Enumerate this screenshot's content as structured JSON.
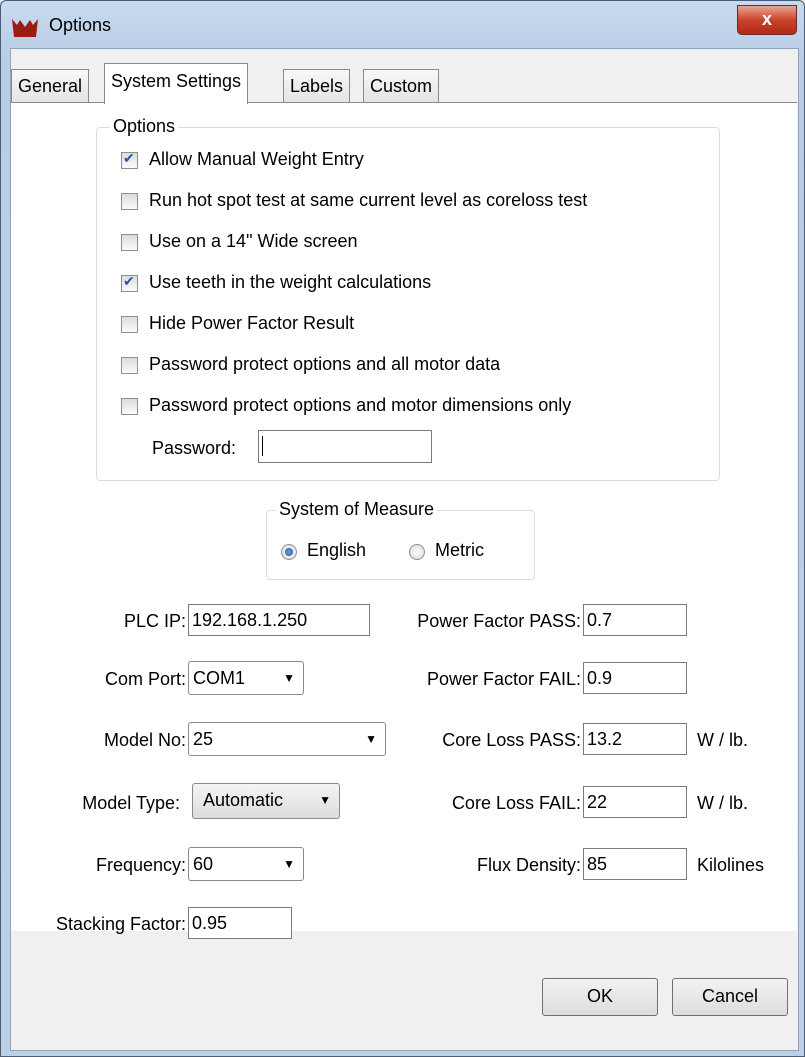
{
  "window": {
    "title": "Options",
    "close_glyph": "x"
  },
  "tabs": [
    {
      "label": "General"
    },
    {
      "label": "System Settings",
      "active": true
    },
    {
      "label": "Labels"
    },
    {
      "label": "Custom"
    }
  ],
  "options_group": {
    "legend": "Options",
    "checkboxes": [
      {
        "label": "Allow Manual Weight Entry",
        "checked": true
      },
      {
        "label": "Run hot spot test at same current level as coreloss test",
        "checked": false
      },
      {
        "label": "Use on a 14\" Wide screen",
        "checked": false
      },
      {
        "label": "Use teeth in the weight calculations",
        "checked": true
      },
      {
        "label": "Hide Power Factor Result",
        "checked": false
      },
      {
        "label": "Password protect options and all motor data",
        "checked": false
      },
      {
        "label": "Password protect options and motor dimensions only",
        "checked": false
      }
    ],
    "password_label": "Password:",
    "password_value": ""
  },
  "measure_group": {
    "legend": "System of Measure",
    "options": [
      {
        "label": "English",
        "selected": true
      },
      {
        "label": "Metric",
        "selected": false
      }
    ]
  },
  "fields": {
    "plc_ip": {
      "label": "PLC IP:",
      "value": "192.168.1.250"
    },
    "com_port": {
      "label": "Com Port:",
      "value": "COM1"
    },
    "model_no": {
      "label": "Model No:",
      "value": "25"
    },
    "model_type": {
      "label": "Model Type:",
      "value": "Automatic"
    },
    "frequency": {
      "label": "Frequency:",
      "value": "60"
    },
    "stacking_factor": {
      "label": "Stacking Factor:",
      "value": "0.95"
    },
    "pf_pass": {
      "label": "Power Factor PASS:",
      "value": "0.7"
    },
    "pf_fail": {
      "label": "Power Factor FAIL:",
      "value": "0.9"
    },
    "cl_pass": {
      "label": "Core Loss PASS:",
      "value": "13.2",
      "unit": "W / lb."
    },
    "cl_fail": {
      "label": "Core Loss FAIL:",
      "value": "22",
      "unit": "W / lb."
    },
    "flux": {
      "label": "Flux Density:",
      "value": "85",
      "unit": "Kilolines"
    }
  },
  "buttons": {
    "ok": "OK",
    "cancel": "Cancel"
  },
  "colors": {
    "check_mark": "#2c4fa8",
    "close_button": "#c9432c"
  }
}
